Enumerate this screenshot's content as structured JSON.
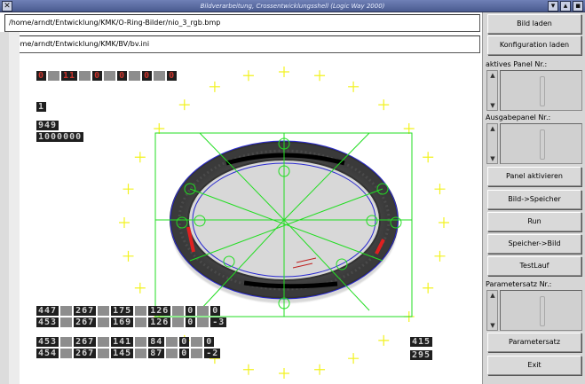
{
  "window": {
    "title": "Bildverarbeitung, Crossentwicklungsshell (Logic Way 2000)",
    "close_glyph": "✕",
    "minimize_glyph": "▾",
    "maximize_glyph": "▴",
    "restore_glyph": "▪"
  },
  "paths": {
    "image_path": "/home/arndt/Entwicklung/KMK/O-Ring-Bilder/nio_3_rgb.bmp",
    "config_path": "/home/arndt/Entwicklung/KMK/BV/bv.ini"
  },
  "buttons": {
    "load_image": "Bild laden",
    "load_config": "Konfiguration laden",
    "activate_panel": "Panel aktivieren",
    "image_to_memory": "Bild->Speicher",
    "run": "Run",
    "memory_to_image": "Speicher->Bild",
    "test_run": "TestLauf",
    "parameter_set": "Parametersatz",
    "exit": "Exit"
  },
  "panels": {
    "active_panel_label": "aktives Panel Nr.:",
    "output_panel_label": "Ausgabepanel Nr.:",
    "parameter_set_label": "Parametersatz Nr.:",
    "spin_up_glyph": "▲",
    "spin_down_glyph": "▼"
  },
  "readouts": {
    "top_row": [
      "0",
      "11",
      "0",
      "0",
      "0",
      "0"
    ],
    "single_value": "1",
    "value_a": "949",
    "value_b": "1000000",
    "table1": [
      [
        "447",
        "267",
        "175",
        "126",
        "0",
        "0"
      ],
      [
        "453",
        "267",
        "169",
        "126",
        "0",
        "-3"
      ]
    ],
    "table2": [
      [
        "453",
        "267",
        "141",
        "84",
        "0",
        "0"
      ],
      [
        "454",
        "267",
        "145",
        "87",
        "0",
        "-2"
      ]
    ],
    "right_values": [
      "415",
      "295"
    ]
  },
  "colors": {
    "overlay_green": "#22dd22",
    "fit_blue": "#2a2ad0",
    "marker_yellow": "#f2f21e",
    "defect_red": "#e02020",
    "ring_dark": "#2b2b2b",
    "seg_red": "#c8342c"
  }
}
